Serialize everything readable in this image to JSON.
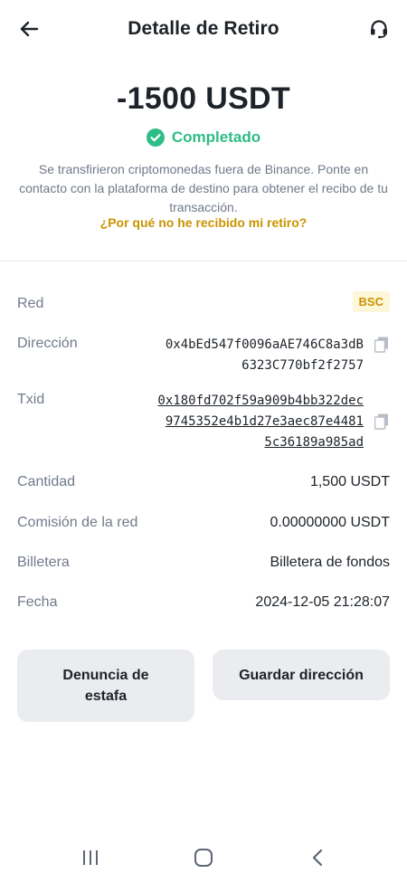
{
  "header": {
    "title": "Detalle de Retiro",
    "back_icon": "arrow-left-icon",
    "support_icon": "headset-icon"
  },
  "summary": {
    "amount": "-1500 USDT",
    "status": "Completado",
    "message": "Se transfirieron criptomonedas fuera de Binance. Ponte en contacto con la plataforma de destino para obtener el recibo de tu transacción.",
    "help_link": "¿Por qué no he recibido mi retiro?"
  },
  "details": {
    "network": {
      "label": "Red",
      "value": "BSC"
    },
    "address": {
      "label": "Dirección",
      "line1": "0x4bEd547f0096aAE746C8a3dB",
      "line2": "6323C770bf2f2757"
    },
    "txid": {
      "label": "Txid",
      "line1": "0x180fd702f59a909b4bb322dec",
      "line2": "9745352e4b1d27e3aec87e4481",
      "line3": "5c36189a985ad"
    },
    "amount": {
      "label": "Cantidad",
      "value": "1,500 USDT"
    },
    "fee": {
      "label": "Comisión de la red",
      "value": "0.00000000 USDT"
    },
    "wallet": {
      "label": "Billetera",
      "value": "Billetera de fondos"
    },
    "date": {
      "label": "Fecha",
      "value": "2024-12-05 21:28:07"
    }
  },
  "actions": {
    "report_scam_line1": "Denuncia de",
    "report_scam_line2": "estafa",
    "save_address": "Guardar dirección"
  },
  "colors": {
    "success": "#2ebd85",
    "accent": "#c99400",
    "text_primary": "#1e2329",
    "text_secondary": "#707a8a",
    "button_bg": "#eaecef"
  }
}
